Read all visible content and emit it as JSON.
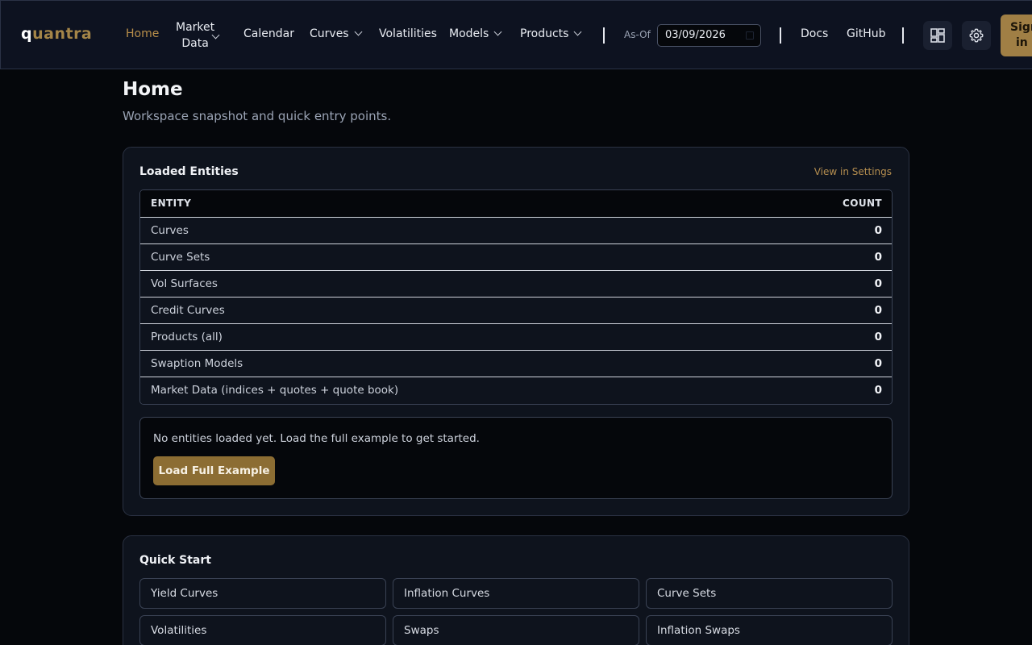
{
  "brand": {
    "logo_first": "q",
    "logo_rest": "uantra"
  },
  "nav": {
    "home": "Home",
    "market_data_line1": "Market",
    "market_data_line2": "Data",
    "calendar": "Calendar",
    "curves": "Curves",
    "volatilities": "Volatilities",
    "models": "Models",
    "products": "Products",
    "asof_label": "As-Of",
    "asof_value": "03/09/2026",
    "docs": "Docs",
    "github": "GitHub",
    "signin_line1": "Sign",
    "signin_line2": "in"
  },
  "page": {
    "title": "Home",
    "subtitle": "Workspace snapshot and quick entry points."
  },
  "entities": {
    "title": "Loaded Entities",
    "view_link": "View in Settings",
    "col_entity": "ENTITY",
    "col_count": "COUNT",
    "rows": [
      {
        "name": "Curves",
        "count": "0"
      },
      {
        "name": "Curve Sets",
        "count": "0"
      },
      {
        "name": "Vol Surfaces",
        "count": "0"
      },
      {
        "name": "Credit Curves",
        "count": "0"
      },
      {
        "name": "Products (all)",
        "count": "0"
      },
      {
        "name": "Swaption Models",
        "count": "0"
      },
      {
        "name": "Market Data (indices + quotes + quote book)",
        "count": "0"
      }
    ],
    "empty_message": "No entities loaded yet. Load the full example to get started.",
    "load_button": "Load Full Example"
  },
  "quick_start": {
    "title": "Quick Start",
    "tiles": [
      "Yield Curves",
      "Inflation Curves",
      "Curve Sets",
      "Volatilities",
      "Swaps",
      "Inflation Swaps"
    ]
  },
  "colors": {
    "accent": "#b98f4a",
    "button": "#8c6d33",
    "background": "#05070b",
    "card": "#0e131d"
  }
}
